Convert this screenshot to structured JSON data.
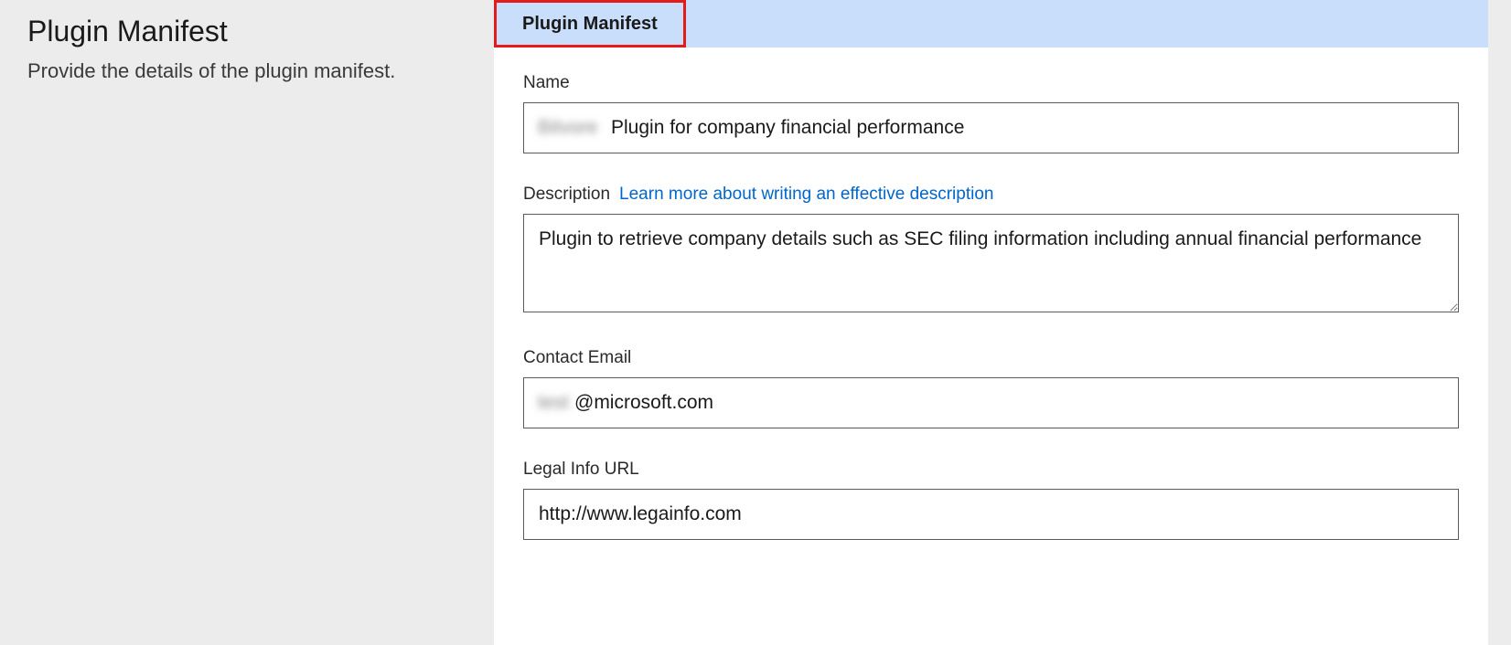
{
  "sidebar": {
    "title": "Plugin Manifest",
    "subtitle": "Provide the details of the plugin manifest."
  },
  "tab": {
    "label": "Plugin Manifest"
  },
  "form": {
    "name": {
      "label": "Name",
      "blurred_prefix": "Bitvore",
      "value": "Plugin for company financial performance"
    },
    "description": {
      "label": "Description",
      "help_link": "Learn more about writing an effective description",
      "value": "Plugin to retrieve company details such as SEC filing information including annual financial performance"
    },
    "contact_email": {
      "label": "Contact Email",
      "blurred_prefix": "test",
      "value": "@microsoft.com"
    },
    "legal_url": {
      "label": "Legal Info URL",
      "value": "http://www.legainfo.com"
    }
  }
}
